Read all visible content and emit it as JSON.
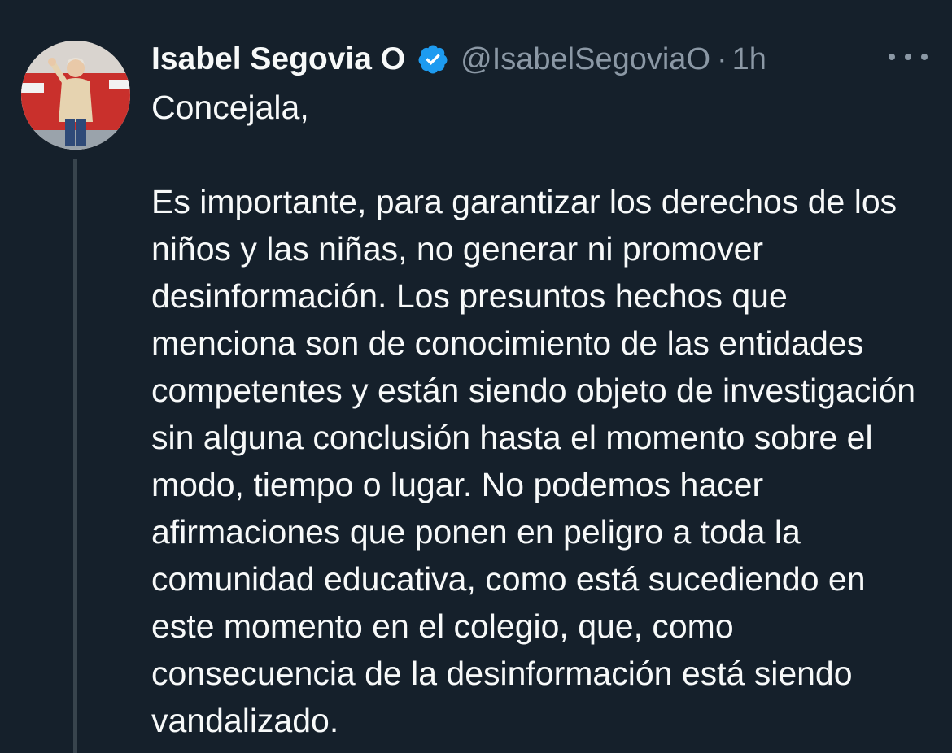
{
  "tweet": {
    "author": {
      "display_name": "Isabel Segovia O",
      "handle": "@IsabelSegoviaO",
      "verified": true,
      "avatar": "profile-photo"
    },
    "separator": "·",
    "time": "1h",
    "more_icon": "more-horizontal-icon",
    "text": "Concejala,\n\nEs importante, para garantizar los derechos de los niños y las niñas, no generar ni promover desinformación. Los presuntos hechos que menciona son de conocimiento de las entidades competentes y están siendo objeto de investigación sin alguna conclusión hasta el momento sobre el modo, tiempo o lugar. No podemos hacer afirmaciones que ponen en peligro a toda la comunidad educativa, como está sucediendo en este momento en el colegio, que, como consecuencia de la desinformación está siendo vandalizado."
  },
  "colors": {
    "background": "#15202b",
    "text_primary": "#f7f9f9",
    "text_secondary": "#8b98a5",
    "verified_badge": "#1d9bf0",
    "thread_line": "#38444d"
  }
}
